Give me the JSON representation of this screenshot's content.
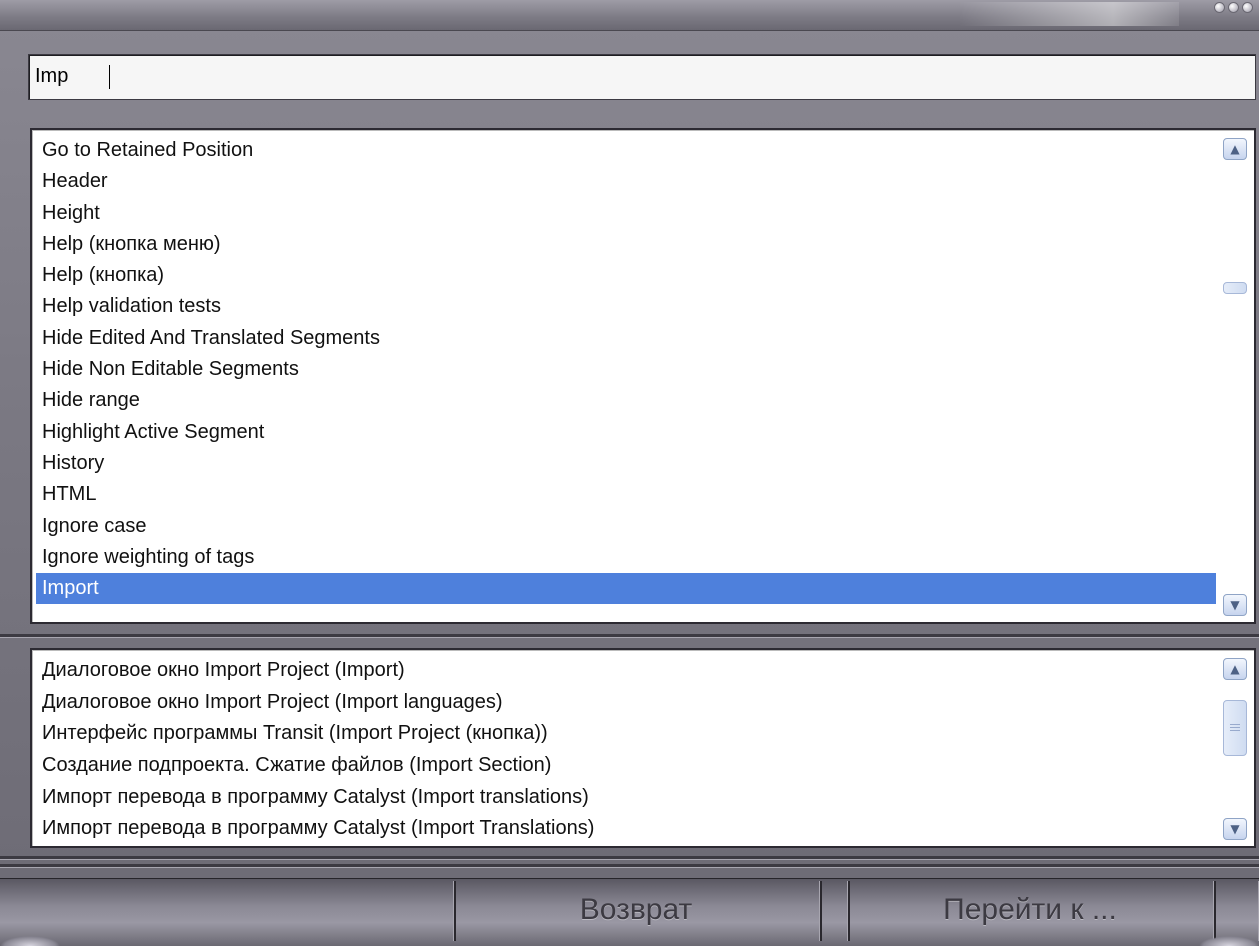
{
  "search": {
    "value": "Imp"
  },
  "index_list": {
    "items": [
      "Go to Retained Position",
      "Header",
      "Height",
      "Help (кнопка меню)",
      "Help (кнопка)",
      "Help validation tests",
      "Hide Edited And Translated Segments",
      "Hide Non Editable Segments",
      "Hide range",
      "Highlight Active Segment",
      "History",
      "HTML",
      "Ignore case",
      "Ignore weighting of tags",
      "Import"
    ],
    "selected_index": 14,
    "selected_color": "#4e80dc"
  },
  "topics_list": {
    "items": [
      "Диалоговое окно Import Project (Import)",
      "Диалоговое окно Import Project (Import languages)",
      "Интерфейс программы Transit (Import Project (кнопка))",
      "Создание подпроекта. Сжатие файлов (Import Section)",
      "Импорт перевода в программу Catalyst (Import translations)",
      "Импорт перевода в программу Catalyst (Import Translations)"
    ]
  },
  "buttons": {
    "back": "Возврат",
    "goto": "Перейти к ..."
  },
  "icons": {
    "scroll_up": "chevron-up-icon",
    "scroll_down": "chevron-down-icon"
  }
}
